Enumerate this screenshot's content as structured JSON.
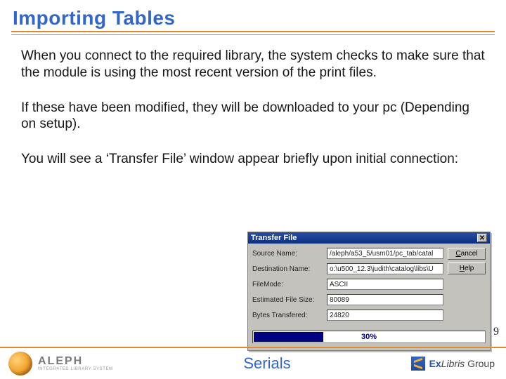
{
  "title": "Importing Tables",
  "paragraphs": [
    "When you connect to the required library, the system checks to make sure that the module is using the most recent version of the print files.",
    "If these have been modified, they will be downloaded to your  pc (Depending on setup).",
    "You will see a ‘Transfer File’ window appear briefly upon initial connection:"
  ],
  "dialog": {
    "title": "Transfer File",
    "close_glyph": "✕",
    "fields": {
      "source_label": "Source Name:",
      "source_value": "/aleph/a53_5/usm01/pc_tab/catal",
      "dest_label": "Destination Name:",
      "dest_value": "o:\\u500_12.3\\judith\\catalog\\libs\\U",
      "mode_label": "FileMode:",
      "mode_value": "ASCII",
      "size_label": "Estimated File Size:",
      "size_value": "80089",
      "bytes_label": "Bytes Transfered:",
      "bytes_value": "24820"
    },
    "buttons": {
      "cancel": "Cancel",
      "help": "Help"
    },
    "progress": {
      "percent": 30,
      "label": "30%"
    }
  },
  "page_number": "9",
  "footer": {
    "aleph_name": "ALEPH",
    "aleph_sub": "INTEGRATED LIBRARY SYSTEM",
    "center": "Serials",
    "exlibris_prefix": "Ex",
    "exlibris_mid": "Libris",
    "exlibris_suffix": " Group"
  }
}
